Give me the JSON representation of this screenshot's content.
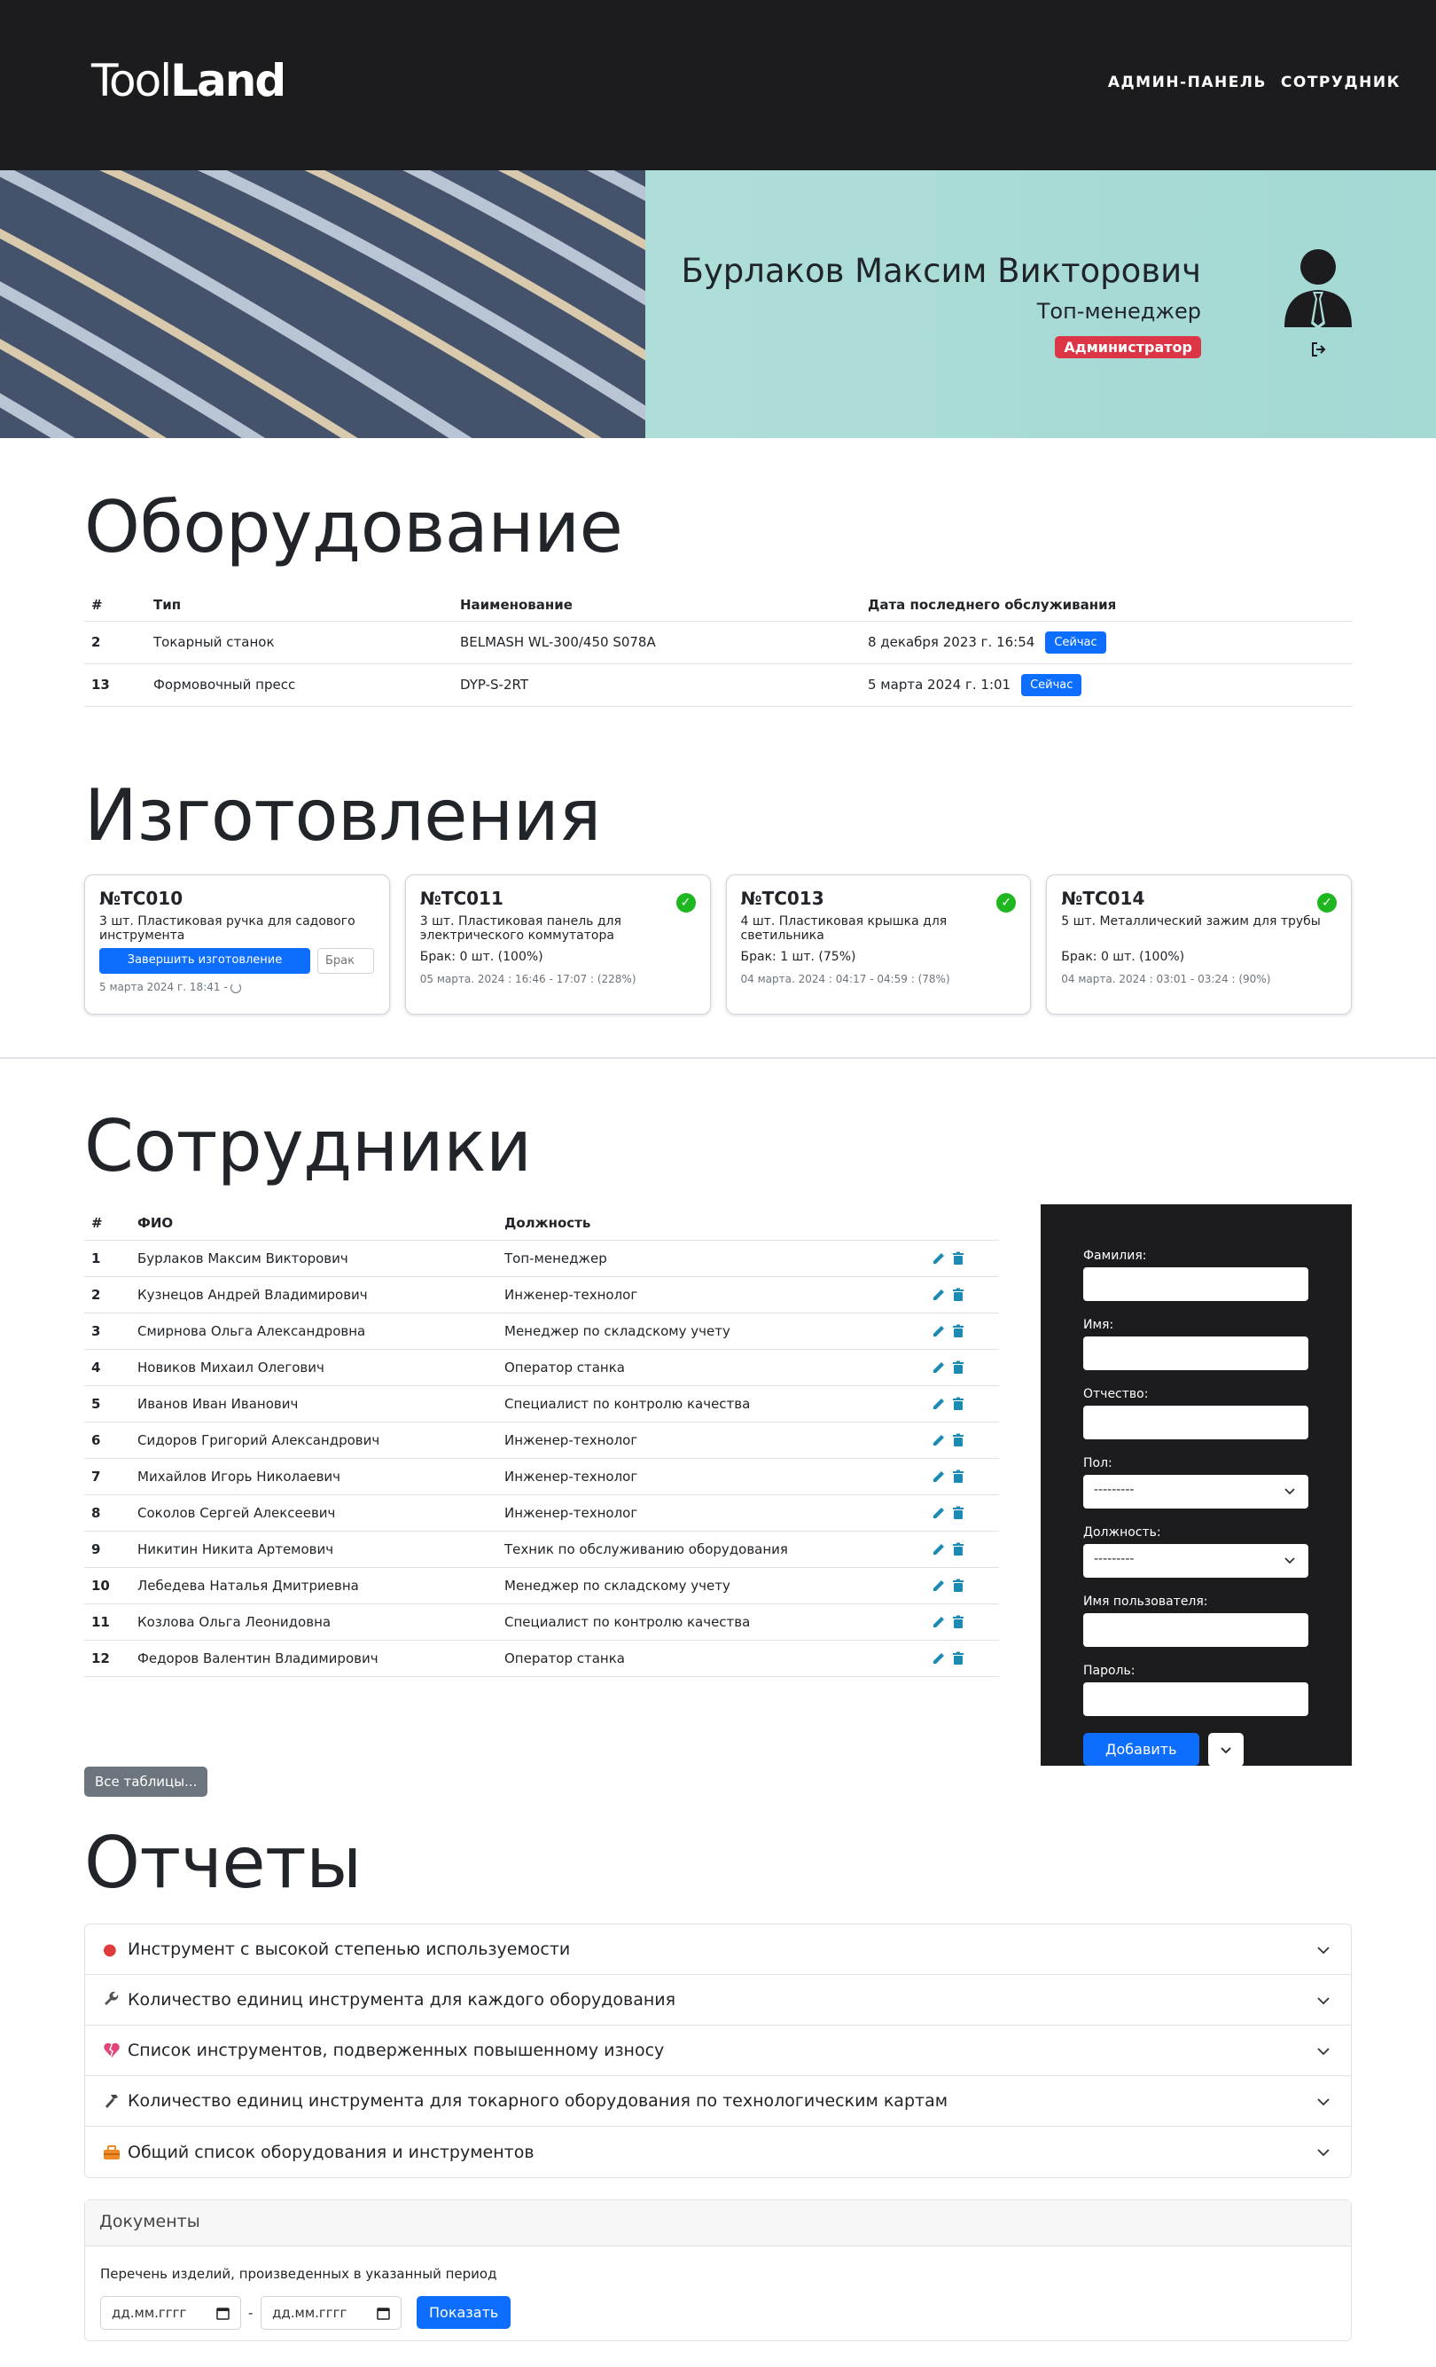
{
  "navbar": {
    "logo_light": "Tool",
    "logo_bold": "Land",
    "links": [
      "АДМИН-ПАНЕЛЬ",
      "СОТРУДНИК"
    ]
  },
  "profile": {
    "name": "Бурлаков Максим Викторович",
    "role": "Топ-менеджер",
    "badge": "Администратор",
    "badge_color": "#dc3545"
  },
  "equipment": {
    "title": "Оборудование",
    "headers": [
      "#",
      "Тип",
      "Наименование",
      "Дата последнего обслуживания"
    ],
    "rows": [
      {
        "id": "2",
        "type": "Токарный станок",
        "name": "BELMASH WL-300/450 S078A",
        "date": "8 декабря 2023 г. 16:54",
        "action": "Сейчас"
      },
      {
        "id": "13",
        "type": "Формовочный пресс",
        "name": "DYP-S-2RT",
        "date": "5 марта 2024 г. 1:01",
        "action": "Сейчас"
      }
    ]
  },
  "manufacturing": {
    "title": "Изготовления",
    "cards": [
      {
        "code": "№TC010",
        "desc": "3 шт. Пластиковая ручка для садового инструмента",
        "finish_label": "Завершить изготовление",
        "defect_placeholder": "Брак",
        "meta": "5 марта 2024 г. 18:41 -"
      },
      {
        "code": "№TC011",
        "desc": "3 шт. Пластиковая панель для электрического коммутатора",
        "defect": "Брак: 0 шт. (100%)",
        "meta": "05 марта. 2024 : 16:46 - 17:07 : (228%)"
      },
      {
        "code": "№TC013",
        "desc": "4 шт. Пластиковая крышка для светильника",
        "defect": "Брак: 1 шт. (75%)",
        "meta": "04 марта. 2024 : 04:17 - 04:59 : (78%)"
      },
      {
        "code": "№TC014",
        "desc": "5 шт. Металлический зажим для трубы",
        "defect": "Брак: 0 шт. (100%)",
        "meta": "04 марта. 2024 : 03:01 - 03:24 : (90%)"
      }
    ]
  },
  "employees": {
    "title": "Сотрудники",
    "headers": [
      "#",
      "ФИО",
      "Должность"
    ],
    "rows": [
      {
        "id": "1",
        "name": "Бурлаков Максим Викторович",
        "position": "Топ-менеджер"
      },
      {
        "id": "2",
        "name": "Кузнецов Андрей Владимирович",
        "position": "Инженер-технолог"
      },
      {
        "id": "3",
        "name": "Смирнова Ольга Александровна",
        "position": "Менеджер по складскому учету"
      },
      {
        "id": "4",
        "name": "Новиков Михаил Олегович",
        "position": "Оператор станка"
      },
      {
        "id": "5",
        "name": "Иванов Иван Иванович",
        "position": "Специалист по контролю качества"
      },
      {
        "id": "6",
        "name": "Сидоров Григорий Александрович",
        "position": "Инженер-технолог"
      },
      {
        "id": "7",
        "name": "Михайлов Игорь Николаевич",
        "position": "Инженер-технолог"
      },
      {
        "id": "8",
        "name": "Соколов Сергей Алексеевич",
        "position": "Инженер-технолог"
      },
      {
        "id": "9",
        "name": "Никитин Никита Артемович",
        "position": "Техник по обслуживанию оборудования"
      },
      {
        "id": "10",
        "name": "Лебедева Наталья Дмитриевна",
        "position": "Менеджер по складскому учету"
      },
      {
        "id": "11",
        "name": "Козлова Ольга Леонидовна",
        "position": "Специалист по контролю качества"
      },
      {
        "id": "12",
        "name": "Федоров Валентин Владимирович",
        "position": "Оператор станка"
      }
    ],
    "all_tables": "Все таблицы..."
  },
  "form": {
    "last_name": "Фамилия:",
    "first_name": "Имя:",
    "patronymic": "Отчество:",
    "gender": "Пол:",
    "gender_value": "---------",
    "position": "Должность:",
    "position_value": "---------",
    "username": "Имя пользователя:",
    "password": "Пароль:",
    "add": "Добавить"
  },
  "reports": {
    "title": "Отчеты",
    "items": [
      {
        "label": "Инструмент с высокой степенью используемости",
        "icon": "fire-icon"
      },
      {
        "label": "Количество единиц инструмента для каждого оборудования",
        "icon": "wrench-icon"
      },
      {
        "label": "Список инструментов, подверженных повышенному износу",
        "icon": "broken-heart-icon"
      },
      {
        "label": "Количество единиц инструмента для токарного оборудования по технологическим картам",
        "icon": "hammer-icon"
      },
      {
        "label": "Общий список оборудования и инструментов",
        "icon": "toolbox-icon"
      }
    ]
  },
  "documents": {
    "title": "Документы",
    "text": "Перечень изделий, произведенных в указанный период",
    "date_placeholder": "дд.мм.гггг",
    "sep": "-",
    "show": "Показать"
  }
}
